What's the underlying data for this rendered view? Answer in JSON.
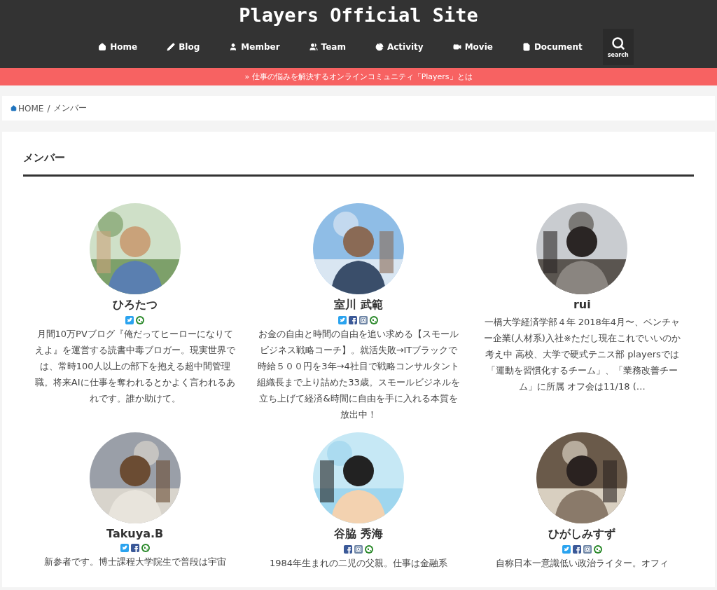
{
  "site_title": "Players Official Site",
  "nav": [
    {
      "label": "Home"
    },
    {
      "label": "Blog"
    },
    {
      "label": "Member"
    },
    {
      "label": "Team"
    },
    {
      "label": "Activity"
    },
    {
      "label": "Movie"
    },
    {
      "label": "Document"
    }
  ],
  "search_label": "search",
  "banner": "» 仕事の悩みを解決するオンラインコミュニティ「Players」とは",
  "breadcrumb": {
    "home": "HOME",
    "separator": "/",
    "current": "メンバー"
  },
  "page_title": "メンバー",
  "members": [
    {
      "name": "ひろたつ",
      "socials": [
        {
          "kind": "twitter"
        },
        {
          "kind": "web"
        }
      ],
      "bio": "月間10万PVブログ『俺だってヒーローになりてえよ』を運営する読書中毒ブロガー。現実世界では、常時100人以上の部下を抱える超中間管理職。将来AIに仕事を奪われるとかよく言われるあれです。誰か助けて。"
    },
    {
      "name": "室川 武範",
      "socials": [
        {
          "kind": "twitter"
        },
        {
          "kind": "facebook"
        },
        {
          "kind": "instagram"
        },
        {
          "kind": "web"
        }
      ],
      "bio": "お金の自由と時間の自由を追い求める【スモールビジネス戦略コーチ】。就活失敗→ITブラックで時給５００円を3年→4社目で戦略コンサルタント組織長まで上り詰めた33歳。スモールビジネルを立ち上げて経済&時間に自由を手に入れる本質を放出中！"
    },
    {
      "name": "rui",
      "bio": "一橋大学経済学部４年 2018年4月〜、ベンチャー企業(人材系)入社※ただし現在これでいいのか考え中 高校、大学で硬式テニス部 playersでは「運動を習慣化するチーム」、「業務改善チーム」に所属 オフ会は11/18 (…"
    },
    {
      "name": "Takuya.B",
      "socials": [
        {
          "kind": "twitter"
        },
        {
          "kind": "facebook"
        },
        {
          "kind": "web"
        }
      ],
      "bio": "新参者です。博士課程大学院生で普段は宇宙"
    },
    {
      "name": "谷脇 秀海",
      "socials": [
        {
          "kind": "facebook"
        },
        {
          "kind": "instagram"
        },
        {
          "kind": "web"
        }
      ],
      "bio": "1984年生まれの二児の父親。仕事は金融系"
    },
    {
      "name": "ひがしみすず",
      "socials": [
        {
          "kind": "twitter"
        },
        {
          "kind": "facebook"
        },
        {
          "kind": "instagram"
        },
        {
          "kind": "web"
        }
      ],
      "bio": "自称日本一意識低い政治ライター。オフィ"
    }
  ]
}
